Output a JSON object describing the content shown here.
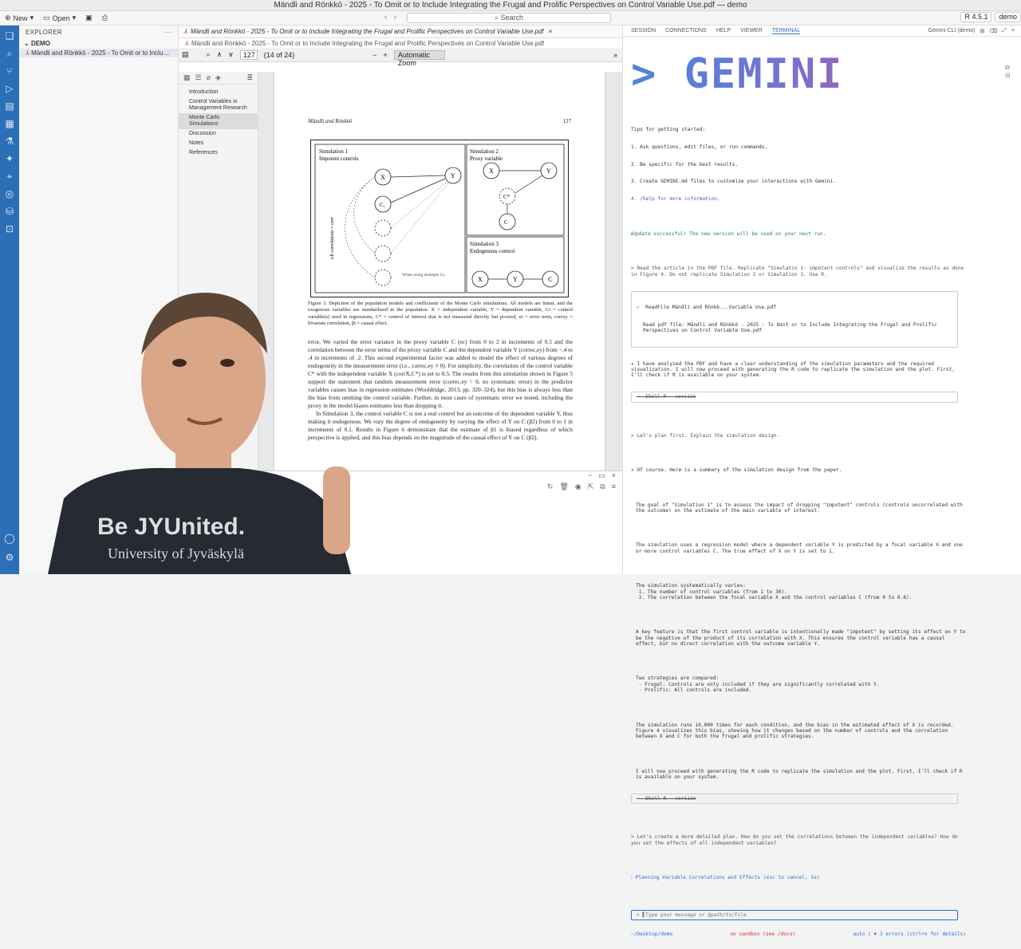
{
  "window": {
    "title": "Mändli and Rönkkö - 2025 - To Omit or to Include Integrating the Frugal and Prolific Perspectives on Control Variable Use.pdf — demo"
  },
  "toolbar": {
    "new_label": "New",
    "open_label": "Open",
    "search_label": "Search",
    "r_version": "R 4.5.1",
    "project_label": "demo"
  },
  "explorer": {
    "header": "EXPLORER",
    "section": "DEMO",
    "file": "Mändli and Rönkkö - 2025 - To Omit or to Include Integrati..."
  },
  "editor": {
    "tab_title": "Mändli and Rönkkö - 2025 - To Omit or to Include Integrating the Frugal and Prolific Perspectives on Control Variable Use.pdf",
    "path": "Mändli and Rönkkö - 2025 - To Omit or to Include Integrating the Frugal and Prolific Perspectives on Control Variable Use.pdf",
    "page_number": "127",
    "page_count": "(14 of 24)",
    "zoom": "Automatic Zoom"
  },
  "outline": [
    "Introduction",
    "Control Variables in Management Research",
    "Monte Carlo Simulations",
    "Discussion",
    "Notes",
    "References"
  ],
  "pdf": {
    "running_head_left": "Mändli and Rönkkö",
    "running_head_right": "127",
    "sim1_title": "Simulation 1",
    "sim1_sub": "Impotent controls",
    "sim2_title": "Simulation 2",
    "sim2_sub": "Proxy variable",
    "sim3_title": "Simulation 3",
    "sim3_sub": "Endogenous control",
    "all_corr": "All correlations = corr",
    "multi_note": "When using multiple Cs,",
    "caption": "Figure 3. Depiction of the population models and coefficients of the Monte Carlo simulations. All models are linear, and the exogenous variables are standardized in the population. X = independent variable, Y = dependent variable, Ci = control variable(s) used in regressions, C* = control of interest that is not measured directly but proxied, ei = error term, corrxy = bivariate correlation, βi = causal effect.",
    "body": "error. We varied the error variance in the proxy variable C (ec) from 0 to 2 in increments of 0.5 and the correlation between the error terms of the proxy variable C and the dependent variable Y (correc,ey) from −.4 to .4 in increments of .2. This second experimental factor was added to model the effect of various degrees of endogeneity in the measurement error (i.e., correc,ey ≠ 0). For simplicity, the correlation of the control variable C* with the independent variable X (corrX,C*) is set to 0.5. The results from this simulation shown in Figure 5 support the statement that random measurement error (correc,ey = 0, no systematic error) in the predictor variables causes bias in regression estimates (Wooldridge, 2013, pp. 320–324), but this bias is always less than the bias from omitting the control variable. Further, in most cases of systematic error we tested, including the proxy in the model biases estimates less than dropping it.",
    "body2": "In Simulation 3, the control variable C is not a real control but an outcome of the dependent variable Y, thus making it endogenous. We vary the degree of endogeneity by varying the effect of Y on C (β2) from 0 to 1 in increments of 0.1. Results in Figure 6 demonstrate that the estimate of β1 is biased regardless of which perspective is applied, and this bias depends on the magnitude of the causal effect of Y on C (β2)."
  },
  "right_tabs": [
    "SESSION",
    "CONNECTIONS",
    "HELP",
    "VIEWER",
    "TERMINAL"
  ],
  "right_tab_extra": "Gemini CLI (demo)",
  "terminal": {
    "logo": "> GEMINI",
    "tips_title": "Tips for getting started:",
    "tips": [
      "1. Ask questions, edit files, or run commands.",
      "2. Be specific for the best results.",
      "3. Create GEMINI.md files to customize your interactions with Gemini.",
      "4. /help for more information."
    ],
    "update": "ℹUpdate successful! The new version will be used on your next run.",
    "prompt1": "> Read the article in the PDF file. Replicate \"Simulatio 1: impotent controls\" and visualize the results as done in Figure 4. Do not replicate Simulation 2 or Simulation 3. Use R.",
    "tool_readfile_name": "✓  ReadFile Mändli and Rönkk...Variable Use.pdf",
    "tool_readfile_out": "Read pdf file: Mändli and Rönkkö - 2025 - To Omit or to Include Integrating the Frugal and Prolific Perspectives on Control Variable Use.pdf",
    "reply1": "✦ I have analyzed the PDF and have a clear understanding of the simulation parameters and the required visualization. I will now proceed with generating the R code to replicate the simulation and the plot. First, I'll check if R is available on your system.",
    "shell1": "−  Shell R --version",
    "prompt2": "> Let's plan first. Explain the simulation design.",
    "reply2": "✦ Of course. Here is a summary of the simulation design from the paper.",
    "para1": "The goal of \"Simulation 1\" is to assess the impact of dropping \"impotent\" controls (controls uncorrelated with the outcome) on the estimate of the main variable of interest.",
    "para2": "The simulation uses a regression model where a dependent variable Y is predicted by a focal variable X and one or more control variables C. The true effect of X on Y is set to 1.",
    "para3": "The simulation systematically varies:\n 1. The number of control variables (from 1 to 30).\n 2. The correlation between the focal variable X and the control variables C (from 0 to 0.8).",
    "para4": "A key feature is that the first control variable is intentionally made \"impotent\" by setting its effect on Y to be the negative of the product of its correlation with X. This ensures the control variable has a causal effect, but no direct correlation with the outcome variable Y.",
    "para5": "Two strategies are compared:\n - Frugal: Controls are only included if they are significantly correlated with Y.\n - Prolific: All controls are included.",
    "para6": "The simulation runs 10,000 times for each condition, and the bias in the estimated effect of X is recorded. Figure 4 visualizes this bias, showing how it changes based on the number of controls and the correlation between X and C for both the frugal and prolific strategies.",
    "para7": "I will now proceed with generating the R code to replicate the simulation and the plot. First, I'll check if R is available on your system.",
    "shell2": "−  Shell R --version",
    "prompt3": "> Let's create a more detailed plan. How do you set the correlations between the independent variables? How do you set the effects of all independent variables?",
    "thinking": "⁝ Planning Variable Correlations and Effects (esc to cancel, 5s)",
    "input_placeholder": "> ▌Type your message or @path/to/file",
    "status_left": "~/Desktop/demo",
    "status_mid": "no sandbox (see /docs)",
    "status_right": "auto | ✖ 3 errors (ctrl+o for details)"
  },
  "webcam_shirt": {
    "line1": "Be JYUnited.",
    "line2": "University of Jyväskylä"
  },
  "colors": {
    "activity_bar": "#2b6fb6",
    "accent": "#1f6fd6"
  }
}
